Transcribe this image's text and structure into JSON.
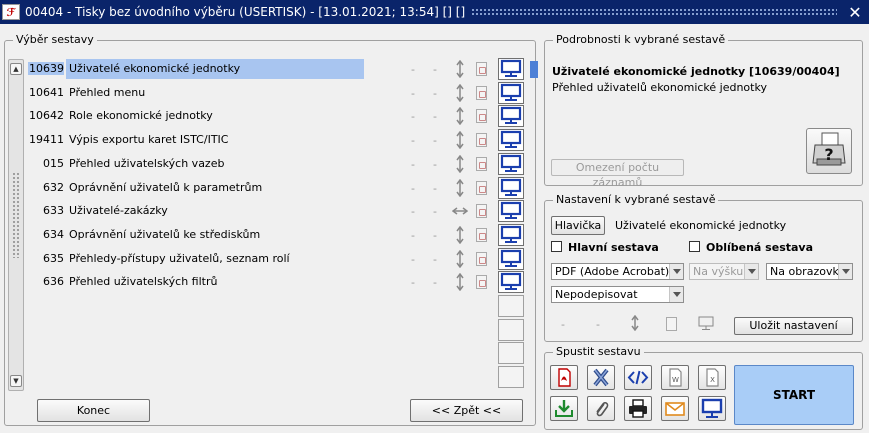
{
  "window": {
    "title": "00404 - Tisky bez úvodního výběru (USERTISK) - [13.01.2021; 13:54]  [] []",
    "app_icon_text": "ℱ",
    "close_symbol": "✕"
  },
  "left_panel": {
    "legend": "Výběr sestavy",
    "reports": [
      {
        "id": "10639",
        "name": "Uživatelé ekonomické jednotky",
        "dash1": "-",
        "dash2": "-",
        "orientation": "vertical",
        "selected": true
      },
      {
        "id": "10641",
        "name": "Přehled menu",
        "dash1": "-",
        "dash2": "-",
        "orientation": "vertical",
        "selected": false
      },
      {
        "id": "10642",
        "name": "Role ekonomické jednotky",
        "dash1": "-",
        "dash2": "-",
        "orientation": "vertical",
        "selected": false
      },
      {
        "id": "19411",
        "name": "Výpis exportu karet ISTC/ITIC",
        "dash1": "-",
        "dash2": "-",
        "orientation": "vertical",
        "selected": false
      },
      {
        "id": "015",
        "name": "Přehled uživatelských vazeb",
        "dash1": "-",
        "dash2": "-",
        "orientation": "vertical",
        "selected": false
      },
      {
        "id": "632",
        "name": "Oprávnění uživatelů k parametrům",
        "dash1": "-",
        "dash2": "-",
        "orientation": "vertical",
        "selected": false
      },
      {
        "id": "633",
        "name": "Uživatelé-zakázky",
        "dash1": "-",
        "dash2": "-",
        "orientation": "horizontal",
        "selected": false
      },
      {
        "id": "634",
        "name": "Oprávnění uživatelů ke střediskům",
        "dash1": "-",
        "dash2": "-",
        "orientation": "vertical",
        "selected": false
      },
      {
        "id": "635",
        "name": "Přehledy-přístupy uživatelů, seznam rolí",
        "dash1": "-",
        "dash2": "-",
        "orientation": "vertical",
        "selected": false
      },
      {
        "id": "636",
        "name": "Přehled uživatelských filtrů",
        "dash1": "-",
        "dash2": "-",
        "orientation": "vertical",
        "selected": false
      }
    ],
    "empty_slots": 4,
    "close_label": "Konec",
    "back_label": "<< Zpět <<"
  },
  "details": {
    "legend": "Podrobnosti k vybrané sestavě",
    "title": "Uživatelé ekonomické jednotky [10639/00404]",
    "subtitle": "Přehled uživatelů ekonomické jednotky",
    "limit_button": "Omezení počtu záznamů"
  },
  "settings": {
    "legend": "Nastavení k vybrané sestavě",
    "header_button": "Hlavička",
    "header_value": "Uživatelé ekonomické jednotky",
    "main_report_label": "Hlavní sestava",
    "favorite_label": "Oblíbená sestava",
    "format_value": "PDF (Adobe Acrobat)",
    "orientation_value": "Na výšku",
    "output_value": "Na obrazovku",
    "sign_value": "Nepodepisovat",
    "dash1": "-",
    "dash2": "-",
    "save_label": "Uložit nastavení"
  },
  "run": {
    "legend": "Spustit sestavu",
    "start_label": "START",
    "buttons": [
      "pdf-icon",
      "excel-x-icon",
      "code-icon",
      "word-icon",
      "xls-file-icon",
      "download-icon",
      "attachment-icon",
      "printer-icon",
      "email-icon",
      "monitor-icon"
    ]
  },
  "colors": {
    "titlebar": "#0a246a",
    "selection": "#a8c5f0",
    "start_button": "#a9cdf7",
    "monitor_blue": "#1b3fae"
  }
}
